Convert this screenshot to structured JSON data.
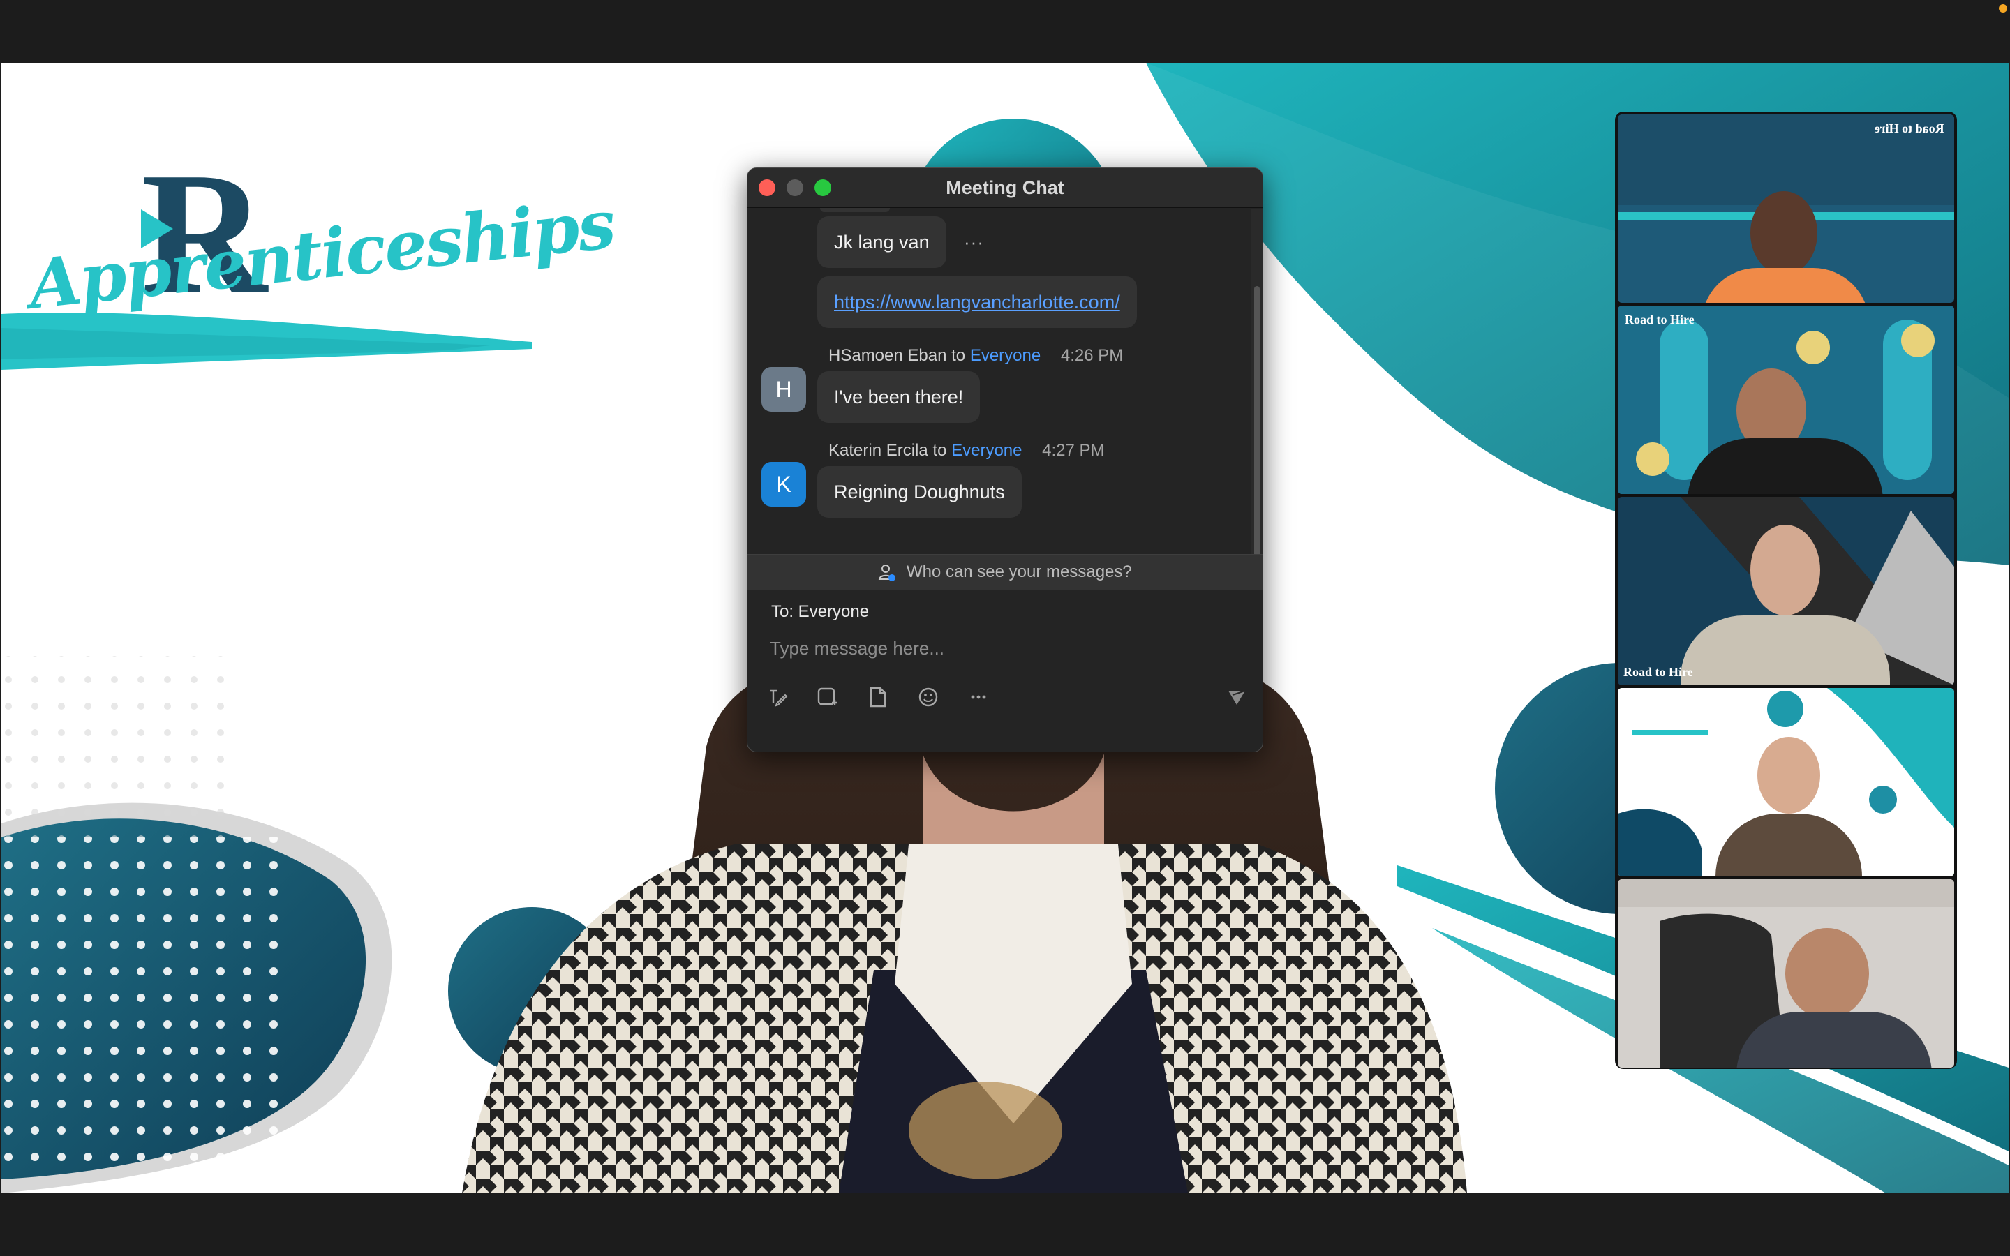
{
  "window": {
    "title": "Meeting Chat"
  },
  "stage": {
    "logo_letter": "R",
    "logo_script": "Apprenticeships"
  },
  "gallery": {
    "tiles": [
      {
        "brand": "Road to Hire",
        "mirrored": true
      },
      {
        "brand": "Road to Hire"
      },
      {
        "brand": "Road to Hire"
      },
      {
        "brand": "",
        "active": true
      },
      {
        "brand": ""
      }
    ]
  },
  "chat": {
    "messages": [
      {
        "text": "Jk lang van",
        "more": "···"
      },
      {
        "link": "https://www.langvancharlotte.com/"
      },
      {
        "avatar": "H",
        "avatar_color": "#6b7a89",
        "sender": "HSamoen Eban",
        "to_word": "to",
        "recipient": "Everyone",
        "time": "4:26 PM",
        "text": "I've been there!"
      },
      {
        "avatar": "K",
        "avatar_color": "#1a82d6",
        "sender": "Katerin Ercila",
        "to_word": "to",
        "recipient": "Everyone",
        "time": "4:27 PM",
        "text": "Reigning Doughnuts"
      }
    ],
    "visibility_prompt": "Who can see your messages?",
    "to_label": "To: Everyone",
    "input_placeholder": "Type message here...",
    "toolbar_icons": [
      "format-text-icon",
      "screenshot-icon",
      "file-icon",
      "emoji-icon",
      "more-icon",
      "send-icon"
    ]
  },
  "colors": {
    "accent_teal": "#27c3c7",
    "navy": "#1c4a63",
    "link": "#5aa0ff",
    "recipient": "#4c9cff",
    "active_speaker": "#32d74b"
  }
}
